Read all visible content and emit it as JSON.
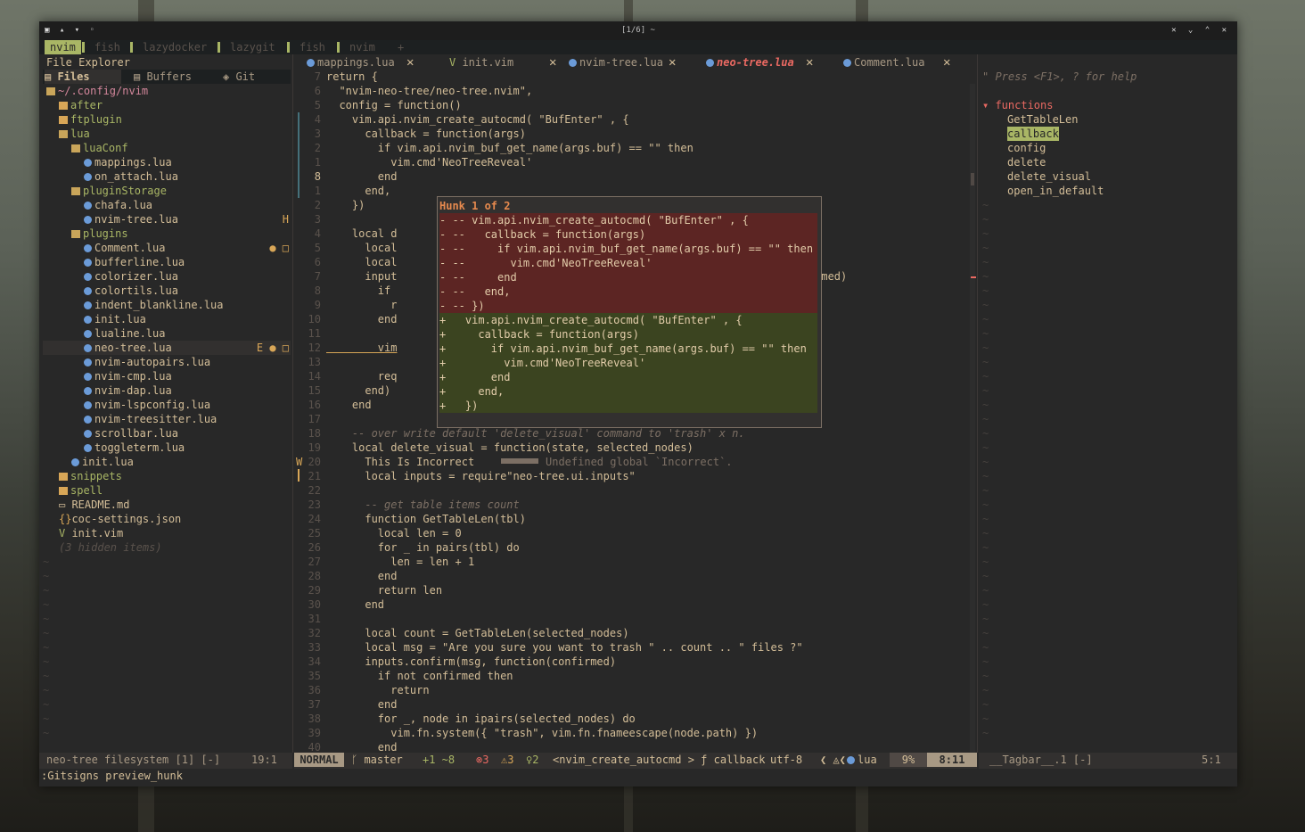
{
  "window": {
    "title": "[1/6] ~",
    "left_icons": "▣ ▴ ▾ ◦",
    "right_icons": "✕ ⌄ ⌃ ✕"
  },
  "tabs": [
    {
      "label": "nvim",
      "active": true
    },
    {
      "label": "fish"
    },
    {
      "label": "lazydocker"
    },
    {
      "label": "lazygit"
    },
    {
      "label": "fish"
    },
    {
      "label": "nvim"
    },
    {
      "label": "+"
    }
  ],
  "explorer": {
    "title": "File Explorer",
    "tabs": {
      "files": "Files",
      "buffers": "Buffers",
      "git": "Git"
    },
    "tree": [
      {
        "text": "~/.config/nvim",
        "type": "root",
        "indent": 0
      },
      {
        "text": "after",
        "type": "dir",
        "indent": 1
      },
      {
        "text": "ftplugin",
        "type": "dir",
        "indent": 1
      },
      {
        "text": "lua",
        "type": "diropen",
        "indent": 1
      },
      {
        "text": "luaConf",
        "type": "diropen",
        "indent": 2
      },
      {
        "text": "mappings.lua",
        "type": "lua",
        "indent": 3
      },
      {
        "text": "on_attach.lua",
        "type": "lua",
        "indent": 3
      },
      {
        "text": "pluginStorage",
        "type": "diropen",
        "indent": 2
      },
      {
        "text": "chafa.lua",
        "type": "lua",
        "indent": 3
      },
      {
        "text": "nvim-tree.lua",
        "type": "lua",
        "indent": 3,
        "mark": "H"
      },
      {
        "text": "plugins",
        "type": "diropen",
        "indent": 2
      },
      {
        "text": "Comment.lua",
        "type": "lua",
        "indent": 3,
        "mark": "● □"
      },
      {
        "text": "bufferline.lua",
        "type": "lua",
        "indent": 3
      },
      {
        "text": "colorizer.lua",
        "type": "lua",
        "indent": 3
      },
      {
        "text": "colortils.lua",
        "type": "lua",
        "indent": 3
      },
      {
        "text": "indent_blankline.lua",
        "type": "lua",
        "indent": 3
      },
      {
        "text": "init.lua",
        "type": "lua",
        "indent": 3
      },
      {
        "text": "lualine.lua",
        "type": "lua",
        "indent": 3
      },
      {
        "text": "neo-tree.lua",
        "type": "lua",
        "indent": 3,
        "mark": "E ● □",
        "selected": true
      },
      {
        "text": "nvim-autopairs.lua",
        "type": "lua",
        "indent": 3
      },
      {
        "text": "nvim-cmp.lua",
        "type": "lua",
        "indent": 3
      },
      {
        "text": "nvim-dap.lua",
        "type": "lua",
        "indent": 3
      },
      {
        "text": "nvim-lspconfig.lua",
        "type": "lua",
        "indent": 3
      },
      {
        "text": "nvim-treesitter.lua",
        "type": "lua",
        "indent": 3
      },
      {
        "text": "scrollbar.lua",
        "type": "lua",
        "indent": 3
      },
      {
        "text": "toggleterm.lua",
        "type": "lua",
        "indent": 3
      },
      {
        "text": "init.lua",
        "type": "lua",
        "indent": 2
      },
      {
        "text": "snippets",
        "type": "dir",
        "indent": 1
      },
      {
        "text": "spell",
        "type": "dir",
        "indent": 1
      },
      {
        "text": "README.md",
        "type": "md",
        "indent": 1
      },
      {
        "text": "coc-settings.json",
        "type": "json",
        "indent": 1
      },
      {
        "text": "init.vim",
        "type": "vim",
        "indent": 1
      },
      {
        "text": "(3 hidden items)",
        "type": "hidden",
        "indent": 1
      }
    ]
  },
  "buffers": [
    {
      "label": "mappings.lua"
    },
    {
      "label": "init.vim"
    },
    {
      "label": "nvim-tree.lua"
    },
    {
      "label": "neo-tree.lua",
      "active": true
    },
    {
      "label": "Comment.lua"
    }
  ],
  "code": [
    {
      "n": "7",
      "t": "return {"
    },
    {
      "n": "6",
      "t": "  \"nvim-neo-tree/neo-tree.nvim\","
    },
    {
      "n": "5",
      "t": "  config = function()"
    },
    {
      "n": "4",
      "t": "    vim.api.nvim_create_autocmd( \"BufEnter\" , {"
    },
    {
      "n": "3",
      "t": "      callback = function(args)"
    },
    {
      "n": "2",
      "t": "        if vim.api.nvim_buf_get_name(args.buf) == \"\" then"
    },
    {
      "n": "1",
      "t": "          vim.cmd'NeoTreeReveal'"
    },
    {
      "n": "8",
      "t": "        end"
    },
    {
      "n": "1",
      "t": "      end,"
    },
    {
      "n": "2",
      "t": "    })"
    },
    {
      "n": "3",
      "t": ""
    },
    {
      "n": "4",
      "t": "    local d"
    },
    {
      "n": "5",
      "t": "      local"
    },
    {
      "n": "6",
      "t": "      local"
    },
    {
      "n": "7",
      "t": "      input"
    },
    {
      "n": "8",
      "t": "        if"
    },
    {
      "n": "9",
      "t": "          r"
    },
    {
      "n": "10",
      "t": "        end"
    },
    {
      "n": "11",
      "t": ""
    },
    {
      "n": "12",
      "t": "        vim"
    },
    {
      "n": "13",
      "t": ""
    },
    {
      "n": "14",
      "t": "        req"
    },
    {
      "n": "15",
      "t": "      end)"
    },
    {
      "n": "16",
      "t": "    end"
    },
    {
      "n": "17",
      "t": ""
    },
    {
      "n": "18",
      "t": "    -- over write default 'delete_visual' command to 'trash' x n."
    },
    {
      "n": "19",
      "t": "    local delete_visual = function(state, selected_nodes)"
    },
    {
      "n": "20",
      "t": "      This Is Incorrect"
    },
    {
      "n": "21",
      "t": "      local inputs = require\"neo-tree.ui.inputs\""
    },
    {
      "n": "22",
      "t": ""
    },
    {
      "n": "23",
      "t": "      -- get table items count"
    },
    {
      "n": "24",
      "t": "      function GetTableLen(tbl)"
    },
    {
      "n": "25",
      "t": "        local len = 0"
    },
    {
      "n": "26",
      "t": "        for _ in pairs(tbl) do"
    },
    {
      "n": "27",
      "t": "          len = len + 1"
    },
    {
      "n": "28",
      "t": "        end"
    },
    {
      "n": "29",
      "t": "        return len"
    },
    {
      "n": "30",
      "t": "      end"
    },
    {
      "n": "31",
      "t": ""
    },
    {
      "n": "32",
      "t": "      local count = GetTableLen(selected_nodes)"
    },
    {
      "n": "33",
      "t": "      local msg = \"Are you sure you want to trash \" .. count .. \" files ?\""
    },
    {
      "n": "34",
      "t": "      inputs.confirm(msg, function(confirmed)"
    },
    {
      "n": "35",
      "t": "        if not confirmed then"
    },
    {
      "n": "36",
      "t": "          return"
    },
    {
      "n": "37",
      "t": "        end"
    },
    {
      "n": "38",
      "t": "        for _, node in ipairs(selected_nodes) do"
    },
    {
      "n": "39",
      "t": "          vim.fn.system({ \"trash\", vim.fn.fnameescape(node.path) })"
    },
    {
      "n": "40",
      "t": "        end"
    }
  ],
  "diagnostic": "Undefined global `Incorrect`.",
  "confirmed_tail": "confirmed)",
  "hunk": {
    "title": "Hunk 1 of 2",
    "lines": [
      {
        "sign": "-",
        "t": " -- vim.api.nvim_create_autocmd( \"BufEnter\" , {",
        "kind": "del"
      },
      {
        "sign": "-",
        "t": " --   callback = function(args)",
        "kind": "del"
      },
      {
        "sign": "-",
        "t": " --     if vim.api.nvim_buf_get_name(args.buf) == \"\" then",
        "kind": "del"
      },
      {
        "sign": "-",
        "t": " --       vim.cmd'NeoTreeReveal'",
        "kind": "del"
      },
      {
        "sign": "-",
        "t": " --     end",
        "kind": "del"
      },
      {
        "sign": "-",
        "t": " --   end,",
        "kind": "del"
      },
      {
        "sign": "-",
        "t": " -- })",
        "kind": "del"
      },
      {
        "sign": "+",
        "t": "   vim.api.nvim_create_autocmd( \"BufEnter\" , {",
        "kind": "add"
      },
      {
        "sign": "+",
        "t": "     callback = function(args)",
        "kind": "add"
      },
      {
        "sign": "+",
        "t": "       if vim.api.nvim_buf_get_name(args.buf) == \"\" then",
        "kind": "add"
      },
      {
        "sign": "+",
        "t": "         vim.cmd'NeoTreeReveal'",
        "kind": "add"
      },
      {
        "sign": "+",
        "t": "       end",
        "kind": "add"
      },
      {
        "sign": "+",
        "t": "     end,",
        "kind": "add"
      },
      {
        "sign": "+",
        "t": "   })",
        "kind": "add"
      }
    ]
  },
  "tagbar": {
    "help": "\" Press <F1>, ? for help",
    "group": "functions",
    "items": [
      "GetTableLen",
      "callback",
      "config",
      "delete",
      "delete_visual",
      "open_in_default"
    ],
    "selected": "callback"
  },
  "status": {
    "left": "neo-tree filesystem [1] [-]",
    "left_pos": "19:1",
    "mode": "NORMAL",
    "branch": "master",
    "diff": "+1 ~8",
    "errors": "3",
    "warnings": "3",
    "hints": "2",
    "context": "<nvim_create_autocmd > ƒ callback",
    "encoding": "utf-8",
    "filetype": "lua",
    "percent": "9%",
    "pos": "8:11",
    "right": "__Tagbar__.1 [-]",
    "right_pos": "5:1"
  },
  "cmdline": ":Gitsigns preview_hunk",
  "colors": {
    "bg": "#282828",
    "accent": "#a9b665",
    "del": "#5c2523",
    "add": "#3b4420",
    "error": "#ea6962",
    "keyword": "#ea6962",
    "string": "#a9b665"
  }
}
